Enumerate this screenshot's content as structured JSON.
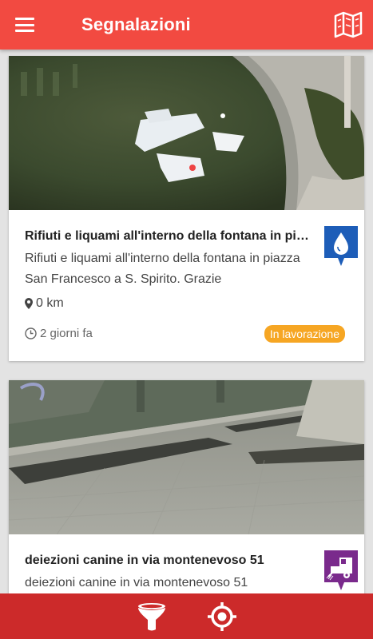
{
  "appbar": {
    "title": "Segnalazioni",
    "menu_icon": "hamburger-menu-icon",
    "map_icon": "map-icon"
  },
  "colors": {
    "appbar": "#f24a41",
    "bottombar": "#cc2a2a",
    "badge_in_progress": "#f6a623",
    "water_category": "#1d5db8",
    "cleaning_category": "#7a2a8c"
  },
  "reports": [
    {
      "title": "Rifiuti e liquami all'interno della fontana in piazza San Francesco a S. Spirito. Grazie",
      "description": "Rifiuti e liquami all'interno della fontana in piazza San Francesco a S. Spirito. Grazie",
      "category_icon": "water-drop-icon",
      "distance": "0 km",
      "time_ago": "2 giorni fa",
      "status": "In lavorazione"
    },
    {
      "title": "deiezioni canine in via montenevoso 51",
      "description": "deiezioni canine in via montenevoso 51",
      "category_icon": "street-sweeper-icon"
    }
  ],
  "bottombar": {
    "filter_icon": "filter-funnel-icon",
    "location_icon": "my-location-icon"
  }
}
